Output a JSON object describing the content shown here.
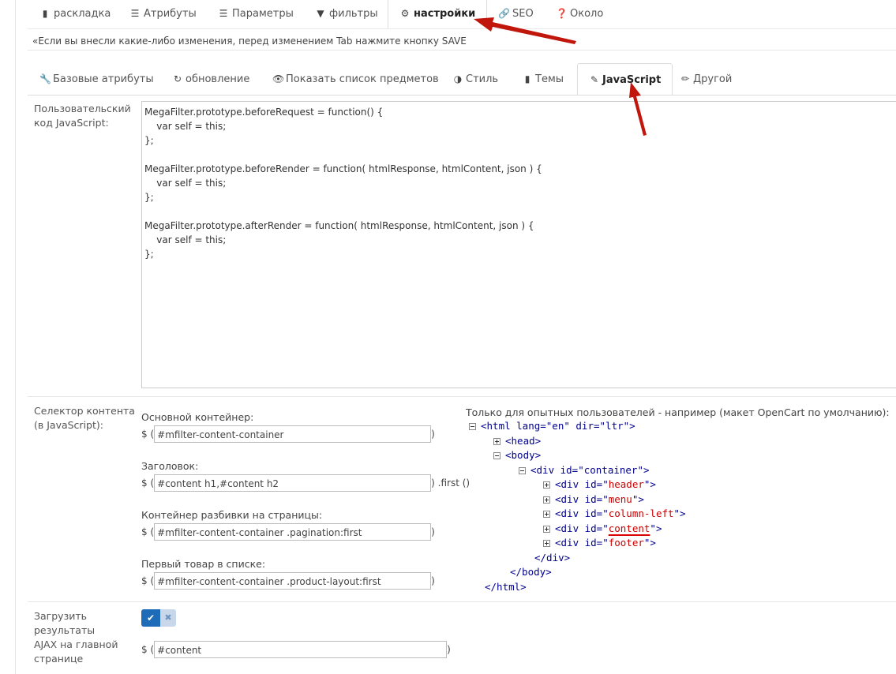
{
  "top_tabs": [
    {
      "label": "раскладка",
      "icon": "file-icon"
    },
    {
      "label": "Атрибуты",
      "icon": "list-icon"
    },
    {
      "label": "Параметры",
      "icon": "list-icon"
    },
    {
      "label": "фильтры",
      "icon": "filter-icon"
    },
    {
      "label": "настройки",
      "icon": "gear-icon",
      "active": true
    },
    {
      "label": "SEO",
      "icon": "link-icon"
    },
    {
      "label": "Около",
      "icon": "question-circle-icon"
    }
  ],
  "note": "«Если вы внесли какие-либо изменения, перед изменением Tab нажмите кнопку SAVE",
  "sub_tabs": [
    {
      "label": "Базовые атрибуты",
      "icon": "wrench-icon"
    },
    {
      "label": "обновление",
      "icon": "refresh-icon"
    },
    {
      "label": "Показать список предметов",
      "icon": "eye-icon"
    },
    {
      "label": "Стиль",
      "icon": "half-circle-icon"
    },
    {
      "label": "Темы",
      "icon": "file-icon"
    },
    {
      "label": "JavaScript",
      "icon": "edit-icon",
      "active": true
    },
    {
      "label": "Другой",
      "icon": "pencil-icon"
    }
  ],
  "js_section": {
    "label": "Пользовательский код JavaScript:",
    "code": "MegaFilter.prototype.beforeRequest = function() {\n\tvar self = this;\n};\n\nMegaFilter.prototype.beforeRender = function( htmlResponse, htmlContent, json ) {\n\tvar self = this;\n};\n\nMegaFilter.prototype.afterRender = function( htmlResponse, htmlContent, json ) {\n\tvar self = this;\n};"
  },
  "selector_section": {
    "label": "Селектор контента (в JavaScript):",
    "prefix": "$ (",
    "suffix": ")",
    "fields": [
      {
        "label": "Основной контейнер:",
        "value": "#mfilter-content-container",
        "suffix": ")"
      },
      {
        "label": "Заголовок:",
        "value": "#content h1,#content h2",
        "suffix": ") .first ()"
      },
      {
        "label": "Контейнер разбивки на страницы:",
        "value": "#mfilter-content-container .pagination:first",
        "suffix": ")"
      },
      {
        "label": "Первый товар в списке:",
        "value": "#mfilter-content-container .product-layout:first",
        "suffix": ")"
      }
    ],
    "tree_title": "Только для опытных пользователей - например (макет OpenCart по умолчанию):",
    "tree": {
      "html_open": "<html lang=\"en\" dir=\"ltr\">",
      "head": "<head>",
      "body": "<body>",
      "container": "<div id=\"container\">",
      "children": [
        "header",
        "menu",
        "column-left",
        "content",
        "footer"
      ],
      "div_prefix": "<div id=\"",
      "div_suffix": "\">",
      "div_close": "</div>",
      "body_close": "</body>",
      "html_close": "</html>"
    }
  },
  "ajax_section": {
    "label": "Загрузить результаты AJAX на главной странице",
    "toggle_on": true,
    "prefix": "$ (",
    "value": "#content",
    "suffix": ")"
  }
}
